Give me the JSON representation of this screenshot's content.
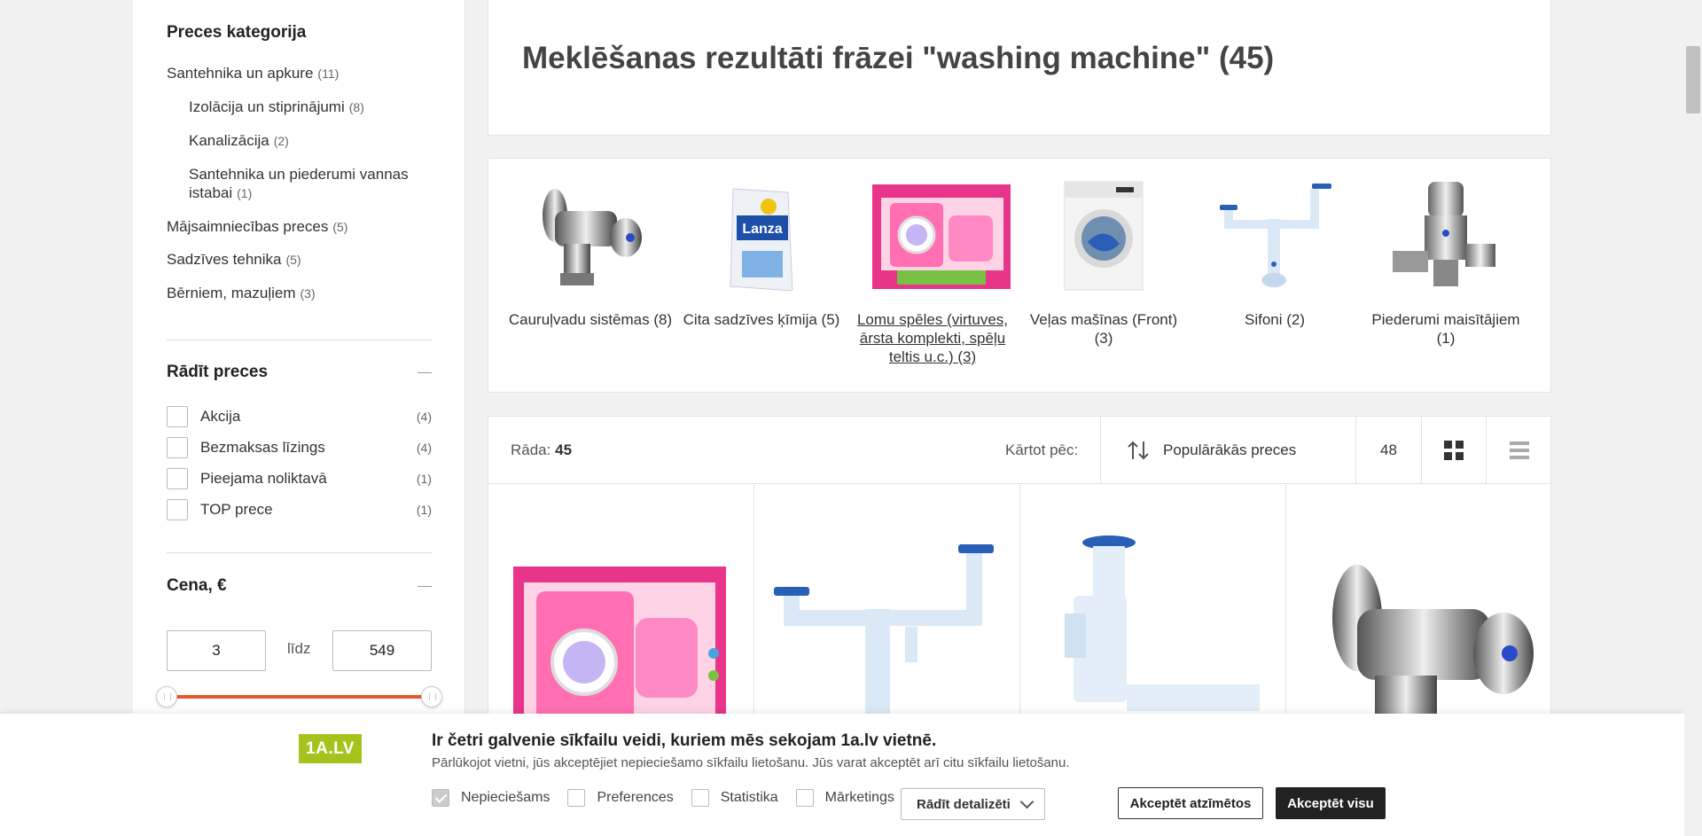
{
  "sidebar": {
    "category_title": "Preces kategorija",
    "categories": [
      {
        "label": "Santehnika un apkure",
        "count": "(11)"
      },
      {
        "label": "Izolācija un stiprinājumi",
        "count": "(8)"
      },
      {
        "label": "Kanalizācija",
        "count": "(2)"
      },
      {
        "label": "Santehnika un piederumi vannas istabai",
        "count": "(1)"
      },
      {
        "label": "Mājsaimniecības preces",
        "count": "(5)"
      },
      {
        "label": "Sadzīves tehnika",
        "count": "(5)"
      },
      {
        "label": "Bērniem, mazuļiem",
        "count": "(3)"
      }
    ],
    "show_title": "Rādīt preces",
    "filters": [
      {
        "label": "Akcija",
        "count": "(4)"
      },
      {
        "label": "Bezmaksas līzings",
        "count": "(4)"
      },
      {
        "label": "Pieejama noliktavā",
        "count": "(1)"
      },
      {
        "label": "TOP prece",
        "count": "(1)"
      }
    ],
    "price_title": "Cena, €",
    "price_min": "3",
    "price_max": "549",
    "price_separator": "līdz"
  },
  "search": {
    "title_prefix": "Meklēšanas rezultāti frāzei \"",
    "query": "washing machine",
    "title_suffix": "\" (45)"
  },
  "category_cards": [
    {
      "label": "Cauruļvadu sistēmas (8)",
      "icon": "valve-image"
    },
    {
      "label": "Cita sadzīves ķīmija (5)",
      "icon": "detergent-box-image"
    },
    {
      "label": "Lomu spēles (virtuves, ārsta komplekti, spēļu teltis u.c.) (3)",
      "icon": "toy-washing-machine-image"
    },
    {
      "label": "Veļas mašīnas (Front) (3)",
      "icon": "washing-machine-image"
    },
    {
      "label": "Sifoni (2)",
      "icon": "siphon-image"
    },
    {
      "label": "Piederumi maisītājiem (1)",
      "icon": "tee-valve-image"
    }
  ],
  "toolbar": {
    "showing_label": "Rāda:",
    "showing_count": "45",
    "sort_label": "Kārtot pēc:",
    "sort_value": "Populārākās preces",
    "per_page": "48"
  },
  "cookie": {
    "logo": "1A.LV",
    "title": "Ir četri galvenie sīkfailu veidi, kuriem mēs sekojam 1a.lv vietnē.",
    "description": "Pārlūkojot vietni, jūs akceptējiet nepieciešamo sīkfailu lietošanu. Jūs varat akceptēt arī citu sīkfailu lietošanu.",
    "options": [
      "Nepieciešams",
      "Preferences",
      "Statistika",
      "Mārketings"
    ],
    "details_label": "Rādīt detalizēti",
    "accept_selected": "Akceptēt atzīmētos",
    "accept_all": "Akceptēt visu"
  },
  "colors": {
    "accent": "#e8562a",
    "brand_green": "#a4c41d"
  }
}
